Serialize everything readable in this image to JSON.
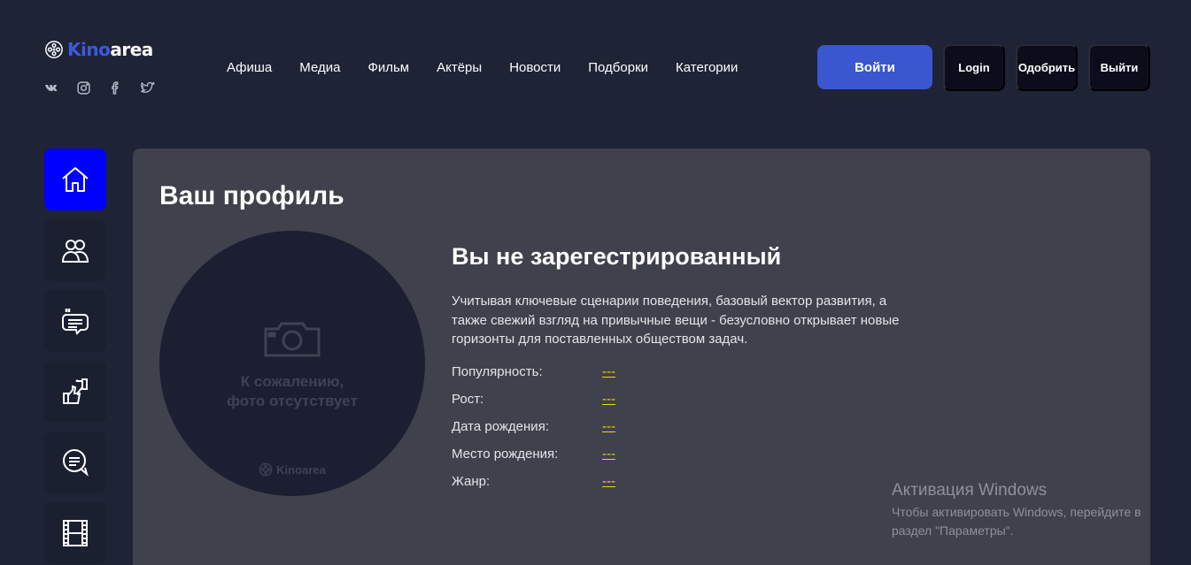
{
  "brand": {
    "part1": "Kino",
    "part2": "area"
  },
  "socials": [
    "vk-icon",
    "instagram-icon",
    "facebook-icon",
    "twitter-icon"
  ],
  "nav": [
    "Афиша",
    "Медиа",
    "Фильм",
    "Актёры",
    "Новости",
    "Подборки",
    "Категории"
  ],
  "header_buttons": {
    "primary": "Войти",
    "login": "Login",
    "approve": "Одобрить",
    "logout": "Выйти"
  },
  "sidebar": [
    "home-icon",
    "users-icon",
    "quotes-chat-icon",
    "thumbs-icon",
    "chat-icon",
    "film-icon"
  ],
  "profile": {
    "title": "Ваш профиль",
    "no_photo": "К сожалению,\nфото отсутствует",
    "watermark": "Kinoarea",
    "status": "Вы не зарегестрированный",
    "description": "Учитывая ключевые сценарии поведения, базовый вектор развития, а также свежий взгляд на привычные вещи - безусловно открывает новые горизонты для поставленных обществом задач.",
    "fields": [
      {
        "label": "Популярность:",
        "value": "---"
      },
      {
        "label": "Рост:",
        "value": "---"
      },
      {
        "label": "Дата рождения:",
        "value": "---"
      },
      {
        "label": "Место рождения:",
        "value": "---"
      },
      {
        "label": "Жанр:",
        "value": "---"
      }
    ]
  },
  "windows_activation": {
    "title": "Активация Windows",
    "text": "Чтобы активировать Windows, перейдите в\nраздел \"Параметры\"."
  },
  "colors": {
    "background": "#1e2336",
    "panel": "#3f414c",
    "accent": "#3a57d0",
    "active": "#0000ff",
    "link": "#ffd400"
  }
}
